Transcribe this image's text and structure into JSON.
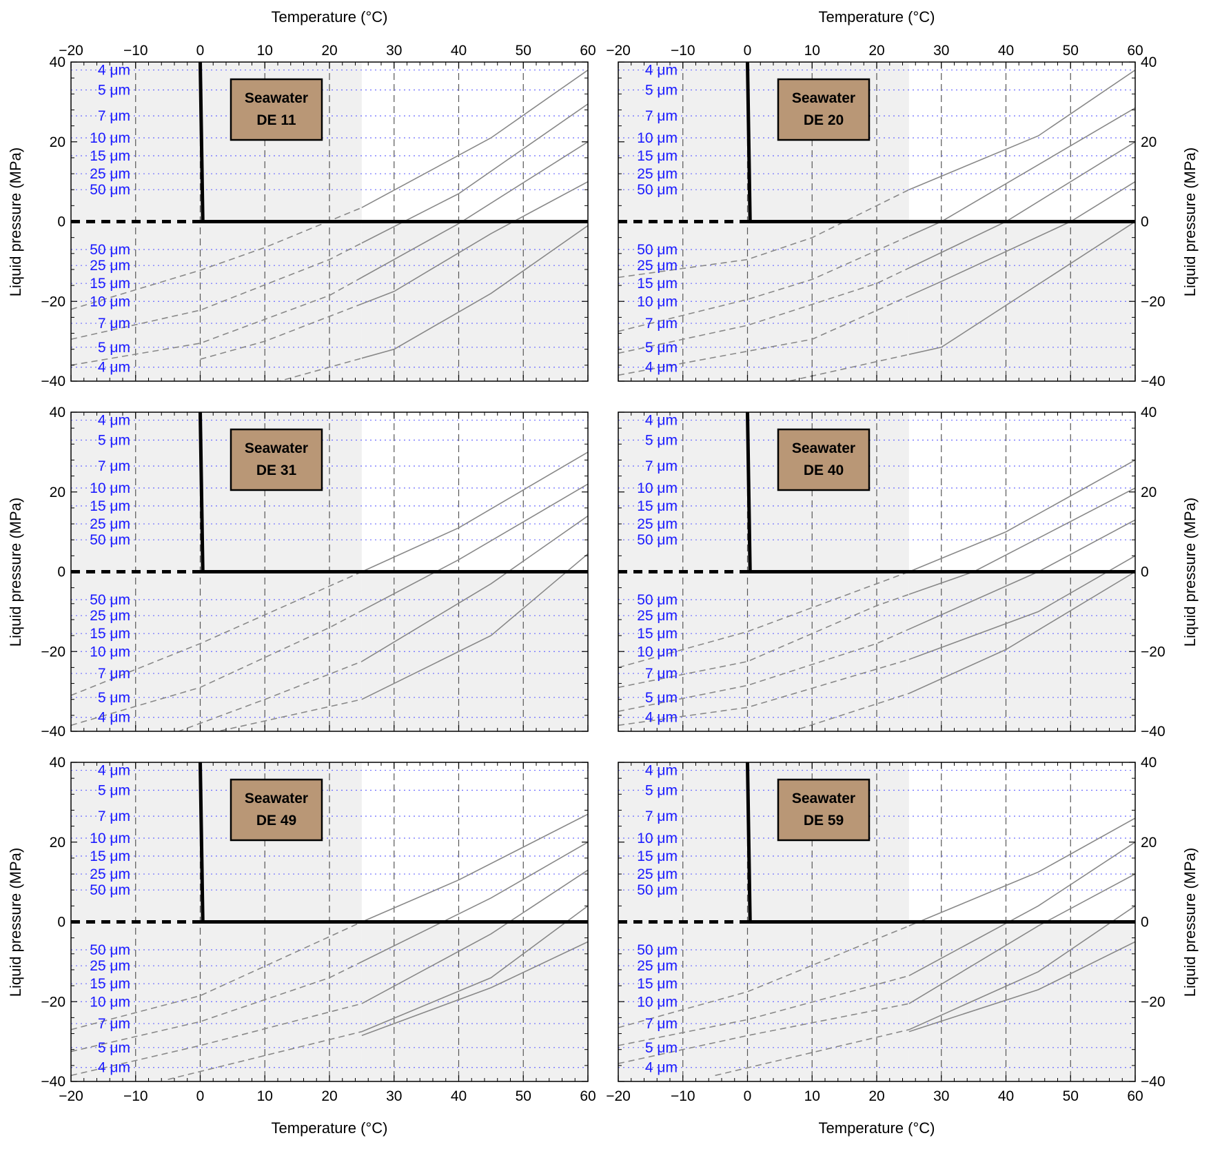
{
  "figure": {
    "top_xlabel": "Temperature (°C)",
    "bottom_xlabel": "Temperature (°C)",
    "left_ylabel": "Liquid pressure (MPa)",
    "right_ylabel": "Liquid pressure (MPa)"
  },
  "chart_data": {
    "type": "line",
    "xlabel": "Temperature (°C)",
    "ylabel": "Liquid pressure (MPa)",
    "xlim": [
      -20,
      60
    ],
    "ylim": [
      -40,
      40
    ],
    "x_ticks": [
      -20,
      -10,
      0,
      10,
      20,
      30,
      40,
      50,
      60
    ],
    "y_ticks": [
      -40,
      -20,
      0,
      20,
      40
    ],
    "x_tick_labels": [
      "−20",
      "−10",
      "0",
      "10",
      "20",
      "30",
      "40",
      "50",
      "60"
    ],
    "y_tick_labels": [
      "−40",
      "−20",
      "0",
      "20",
      "40"
    ],
    "grid": "vertical dashed at x ticks; horizontal dotted blue at curve label levels",
    "shaded_region": "x < 25 °C and y < 0 shaded light gray",
    "reference_lines": {
      "solid_zero_line_x_range": [
        0,
        60
      ],
      "dashed_zero_line_x_range": [
        -20,
        0
      ],
      "near_vertical_line_x": [
        0,
        0.4
      ]
    },
    "positive_labels": [
      {
        "text": "4 μm",
        "y": 38
      },
      {
        "text": "5 μm",
        "y": 33
      },
      {
        "text": "7 μm",
        "y": 26.5
      },
      {
        "text": "10 μm",
        "y": 21
      },
      {
        "text": "15 μm",
        "y": 16.5
      },
      {
        "text": "25 μm",
        "y": 12
      },
      {
        "text": "50 μm",
        "y": 8
      }
    ],
    "negative_labels": [
      {
        "text": "50 μm",
        "y": -7
      },
      {
        "text": "25 μm",
        "y": -11
      },
      {
        "text": "15 μm",
        "y": -15.5
      },
      {
        "text": "10 μm",
        "y": -20
      },
      {
        "text": "7 μm",
        "y": -25.5
      },
      {
        "text": "5 μm",
        "y": -31.5
      },
      {
        "text": "4 μm",
        "y": -36.5
      }
    ],
    "panels": [
      {
        "name": "DE 11",
        "badge_line1": "Seawater",
        "badge_line2": "DE 11",
        "series": [
          {
            "x": [
              -20,
              0,
              10,
              25,
              45,
              60
            ],
            "y": [
              -22,
              -12.2,
              -6.5,
              3.5,
              21,
              38
            ]
          },
          {
            "x": [
              -20,
              0,
              20,
              40,
              60
            ],
            "y": [
              -29.5,
              -22.2,
              -9.5,
              7,
              29.5
            ]
          },
          {
            "x": [
              -20,
              0,
              20,
              40,
              60
            ],
            "y": [
              -36,
              -30.5,
              -18.5,
              -0.5,
              20
            ]
          },
          {
            "x": [
              0,
              10,
              30,
              45,
              60
            ],
            "y": [
              -34.5,
              -30,
              -17.5,
              -3,
              10
            ]
          },
          {
            "x": [
              10,
              30,
              45,
              60
            ],
            "y": [
              -41,
              -32,
              -18,
              -1
            ]
          }
        ]
      },
      {
        "name": "DE 20",
        "badge_line1": "Seawater",
        "badge_line2": "DE 20",
        "series": [
          {
            "x": [
              -20,
              0,
              10,
              25,
              45,
              60
            ],
            "y": [
              -14,
              -9.5,
              -4,
              8,
              21.5,
              38
            ]
          },
          {
            "x": [
              -20,
              0,
              10,
              30,
              60
            ],
            "y": [
              -27.5,
              -19.5,
              -14.5,
              0,
              28.5
            ]
          },
          {
            "x": [
              -20,
              0,
              20,
              40,
              60
            ],
            "y": [
              -33,
              -26,
              -15.5,
              0,
              20
            ]
          },
          {
            "x": [
              -20,
              0,
              10,
              30,
              50,
              60
            ],
            "y": [
              -38.5,
              -32.5,
              -29.5,
              -15,
              0,
              10
            ]
          },
          {
            "x": [
              5,
              30,
              60
            ],
            "y": [
              -40.5,
              -31.5,
              0
            ]
          }
        ]
      },
      {
        "name": "DE 31",
        "badge_line1": "Seawater",
        "badge_line2": "DE 31",
        "series": [
          {
            "x": [
              -20,
              0,
              25,
              40,
              60
            ],
            "y": [
              -31,
              -18,
              0,
              11,
              30
            ]
          },
          {
            "x": [
              -20,
              0,
              20,
              40,
              60
            ],
            "y": [
              -38.5,
              -29,
              -14,
              3,
              22
            ]
          },
          {
            "x": [
              -5,
              10,
              25,
              45,
              60
            ],
            "y": [
              -41,
              -32,
              -22.5,
              -3,
              14
            ]
          },
          {
            "x": [
              0,
              25,
              45,
              60
            ],
            "y": [
              -41,
              -32,
              -16,
              4.5
            ]
          }
        ]
      },
      {
        "name": "DE 40",
        "badge_line1": "Seawater",
        "badge_line2": "DE 40",
        "series": [
          {
            "x": [
              -20,
              0,
              25,
              40,
              60
            ],
            "y": [
              -24,
              -15,
              0,
              10,
              28
            ]
          },
          {
            "x": [
              -20,
              0,
              20,
              35,
              60
            ],
            "y": [
              -29,
              -22.5,
              -8.5,
              0,
              21
            ]
          },
          {
            "x": [
              -20,
              0,
              20,
              45,
              60
            ],
            "y": [
              -35,
              -28.5,
              -18,
              0,
              13
            ]
          },
          {
            "x": [
              -20,
              0,
              25,
              45,
              60
            ],
            "y": [
              -38.5,
              -34,
              -22,
              -10,
              4
            ]
          },
          {
            "x": [
              5,
              25,
              40,
              60
            ],
            "y": [
              -41,
              -30.5,
              -19.5,
              0
            ]
          }
        ]
      },
      {
        "name": "DE 49",
        "badge_line1": "Seawater",
        "badge_line2": "DE 49",
        "series": [
          {
            "x": [
              -20,
              0,
              25,
              40,
              60
            ],
            "y": [
              -27,
              -18.5,
              0,
              10.5,
              27
            ]
          },
          {
            "x": [
              -20,
              0,
              20,
              45,
              60
            ],
            "y": [
              -32.5,
              -25,
              -14,
              6,
              20
            ]
          },
          {
            "x": [
              -20,
              0,
              25,
              45,
              60
            ],
            "y": [
              -38.5,
              -31,
              -20.5,
              -3,
              13
            ]
          },
          {
            "x": [
              -5,
              25,
              45,
              60
            ],
            "y": [
              -39.5,
              -27.5,
              -14,
              4
            ]
          },
          {
            "x": [
              25,
              45,
              60
            ],
            "y": [
              -28.5,
              -16.5,
              -5
            ]
          }
        ]
      },
      {
        "name": "DE 59",
        "badge_line1": "Seawater",
        "badge_line2": "DE 59",
        "series": [
          {
            "x": [
              -20,
              0,
              25,
              45,
              60
            ],
            "y": [
              -26.5,
              -17.5,
              -1,
              12.5,
              26
            ]
          },
          {
            "x": [
              -20,
              0,
              25,
              45,
              60
            ],
            "y": [
              -31,
              -24.5,
              -13.5,
              4,
              20
            ]
          },
          {
            "x": [
              -20,
              0,
              25,
              45,
              60
            ],
            "y": [
              -35.5,
              -28.5,
              -20.5,
              -1,
              12
            ]
          },
          {
            "x": [
              -5,
              25,
              45,
              60
            ],
            "y": [
              -38.5,
              -27,
              -12.5,
              4
            ]
          },
          {
            "x": [
              25,
              45,
              60
            ],
            "y": [
              -27.5,
              -17,
              -5
            ]
          }
        ]
      }
    ]
  }
}
